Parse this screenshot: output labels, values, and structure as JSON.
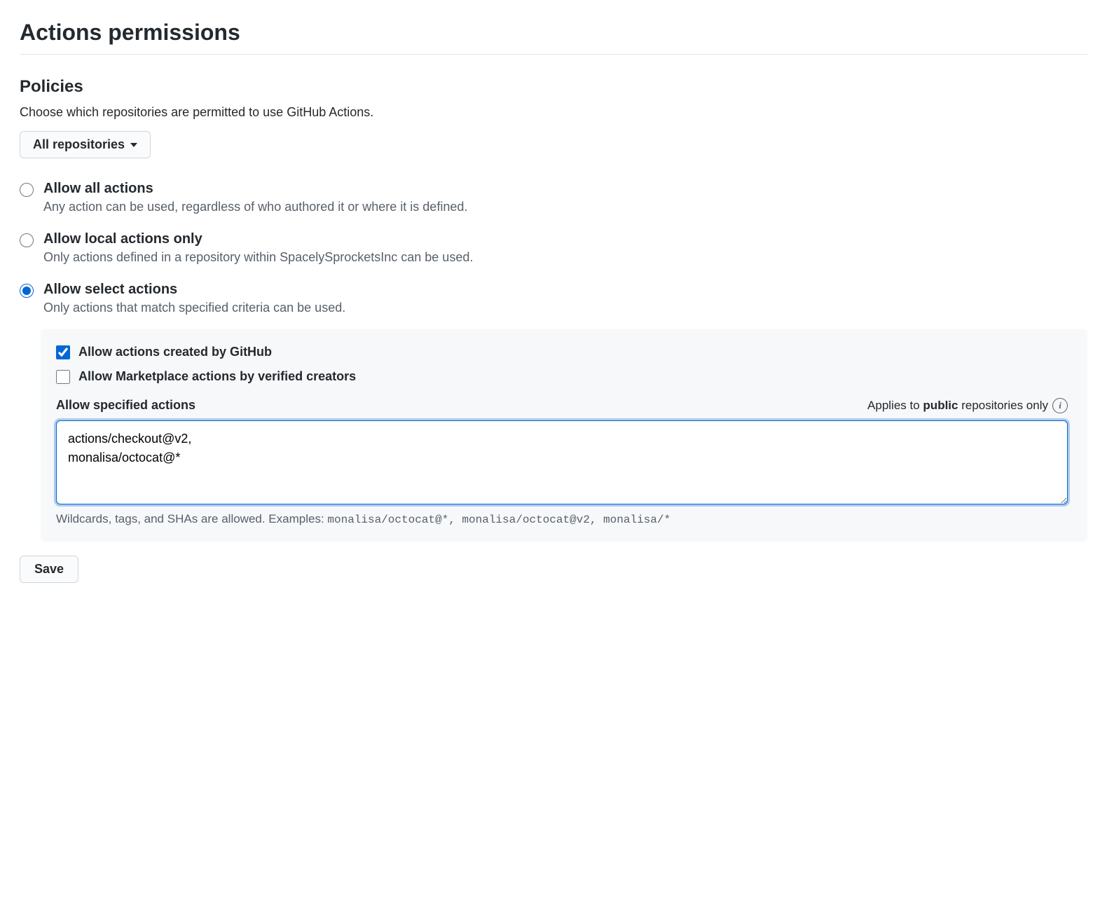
{
  "page": {
    "title": "Actions permissions"
  },
  "policies": {
    "title": "Policies",
    "description": "Choose which repositories are permitted to use GitHub Actions.",
    "repo_selector": "All repositories",
    "options": [
      {
        "label": "Allow all actions",
        "description": "Any action can be used, regardless of who authored it or where it is defined.",
        "checked": false
      },
      {
        "label": "Allow local actions only",
        "description": "Only actions defined in a repository within SpacelySprocketsInc can be used.",
        "checked": false
      },
      {
        "label": "Allow select actions",
        "description": "Only actions that match specified criteria can be used.",
        "checked": true
      }
    ],
    "select_panel": {
      "allow_github": {
        "label": "Allow actions created by GitHub",
        "checked": true
      },
      "allow_marketplace": {
        "label": "Allow Marketplace actions by verified creators",
        "checked": false
      },
      "specified": {
        "title": "Allow specified actions",
        "applies_prefix": "Applies to ",
        "applies_bold": "public",
        "applies_suffix": " repositories only",
        "value": "actions/checkout@v2,\nmonalisa/octocat@*",
        "hint_prefix": "Wildcards, tags, and SHAs are allowed. Examples: ",
        "hint_examples": "monalisa/octocat@*, monalisa/octocat@v2, monalisa/*"
      }
    }
  },
  "buttons": {
    "save": "Save"
  }
}
